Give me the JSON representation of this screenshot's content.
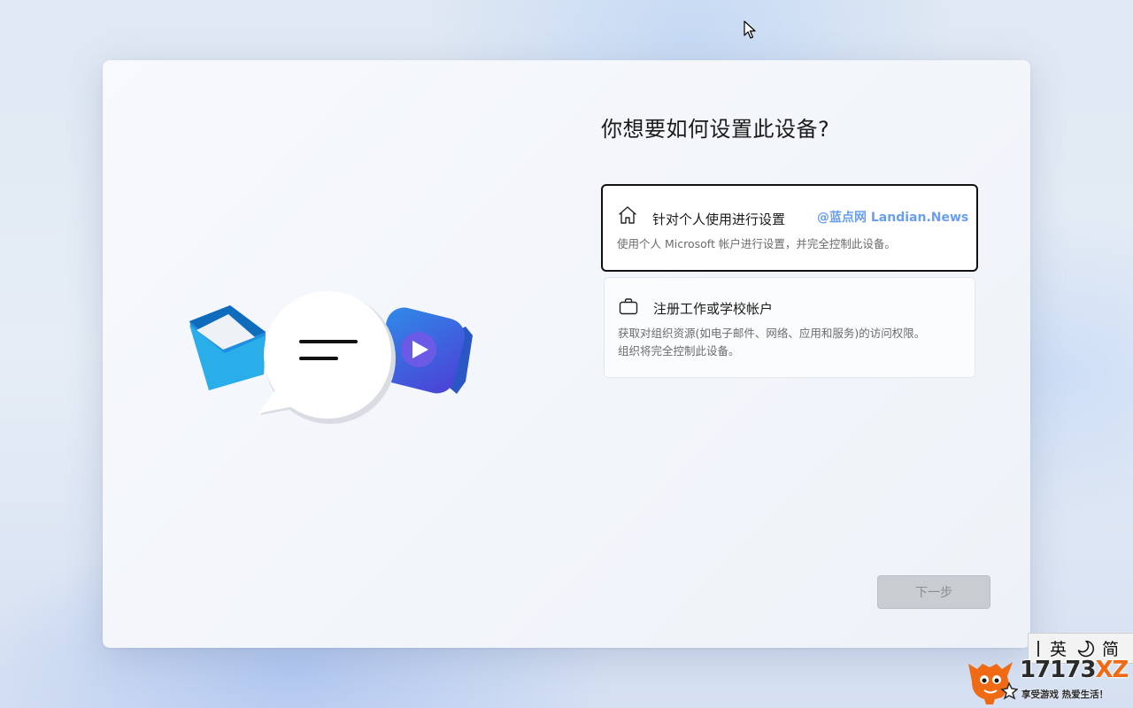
{
  "setup": {
    "title": "你想要如何设置此设备?",
    "options": [
      {
        "icon": "home-icon",
        "title": "针对个人使用进行设置",
        "description": "使用个人 Microsoft 帐户进行设置，并完全控制此设备。",
        "selected": true,
        "watermark": "@蓝点网 Landian.News"
      },
      {
        "icon": "briefcase-icon",
        "title": "注册工作或学校帐户",
        "description_line1": "获取对组织资源(如电子邮件、网络、应用和服务)的访问权限。",
        "description_line2": "组织将完全控制此设备。",
        "selected": false
      }
    ],
    "next_label": "下一步"
  },
  "ime": {
    "mode": "英",
    "script": "简",
    "icon": "moon-icon"
  },
  "brand": {
    "main_number": "17173",
    "main_suffix": "XZ",
    "slogan": "享受游戏 热爱生活！"
  },
  "colors": {
    "watermark": "#6a9ff0",
    "brand_accent": "#f06a13",
    "selected_border": "#111111",
    "disabled_button": "#c9ccd1"
  }
}
